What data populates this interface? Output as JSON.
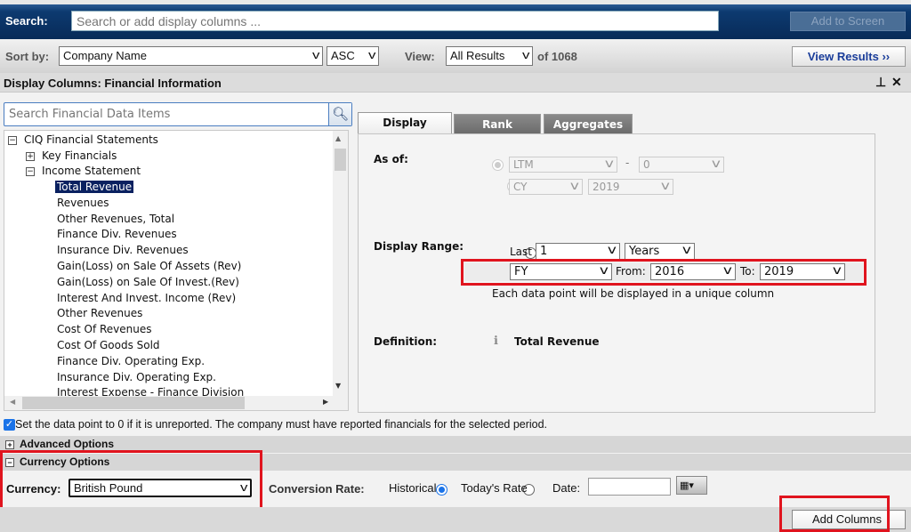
{
  "search": {
    "label": "Search:",
    "placeholder": "Search or add display columns ...",
    "add_button": "Add to Screen"
  },
  "sort": {
    "label": "Sort by:",
    "field": "Company Name",
    "order": "ASC",
    "view_label": "View:",
    "view": "All Results",
    "count": "of 1068",
    "view_results": "View Results ››"
  },
  "panel": {
    "title": "Display Columns: Financial Information",
    "pin_icon": "pin-icon",
    "close_icon": "close-icon"
  },
  "item_search": {
    "placeholder": "Search Financial Data Items"
  },
  "tree": {
    "root": "CIQ Financial Statements",
    "groups": [
      "Key Financials",
      "Income Statement"
    ],
    "items": [
      "Total Revenue",
      "Revenues",
      "Other Revenues, Total",
      "Finance Div. Revenues",
      "Insurance Div. Revenues",
      "Gain(Loss) on Sale Of Assets (Rev)",
      "Gain(Loss) on Sale Of Invest.(Rev)",
      "Interest And Invest. Income (Rev)",
      "Other Revenues",
      "Cost Of Revenues",
      "Cost Of Goods Sold",
      "Finance Div. Operating Exp.",
      "Insurance Div. Operating Exp.",
      "Interest Expense - Finance Division"
    ],
    "selected": "Total Revenue"
  },
  "tabs": [
    "Display",
    "Rank",
    "Aggregates"
  ],
  "display": {
    "as_of_label": "As of:",
    "ltm": "LTM",
    "ltm_offset": "0",
    "cy": "CY",
    "cy_year": "2019",
    "range_label": "Display Range:",
    "last_label": "Last",
    "last_value": "1",
    "last_unit": "Years",
    "period": "FY",
    "from_label": "From:",
    "from": "2016",
    "to_label": "To:",
    "to": "2019",
    "note": "Each data point will be displayed in a unique column",
    "definition_label": "Definition:",
    "definition": "Total Revenue"
  },
  "unreported_checkbox": {
    "label": "Set the data point to 0 if it is unreported. The company must have reported financials for the selected period.",
    "checked": true
  },
  "advanced": "Advanced Options",
  "currency": {
    "section": "Currency Options",
    "label": "Currency:",
    "value": "British Pound",
    "rate_label": "Conversion Rate:",
    "historical": "Historical",
    "today": "Today's Rate",
    "date": "Date:",
    "date_value": ""
  },
  "add_columns": "Add Columns",
  "colors": {
    "highlight": "#e0141e",
    "selection": "#0a2160",
    "topbar": "#0d3a70"
  }
}
